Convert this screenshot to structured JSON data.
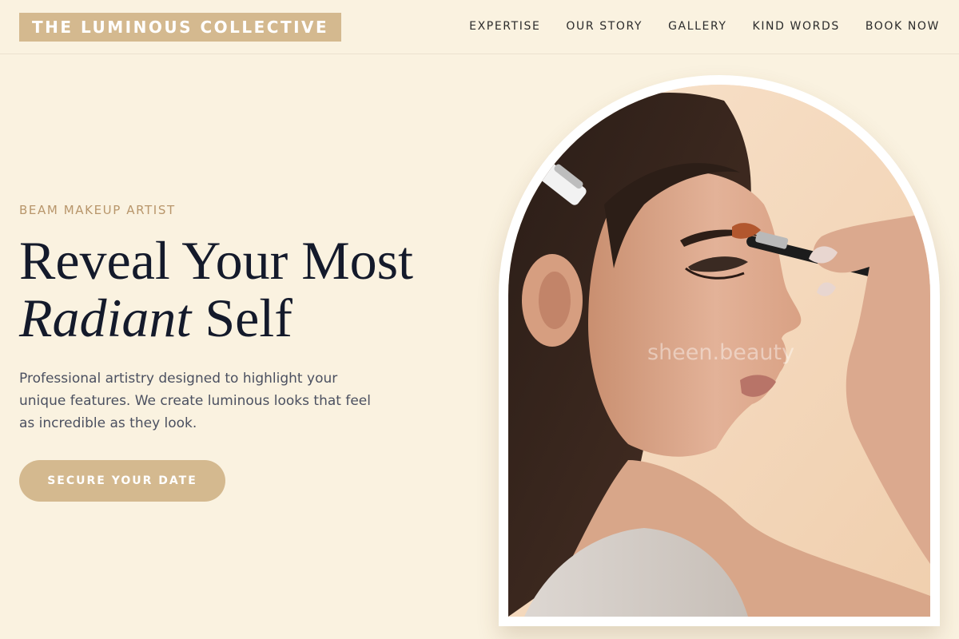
{
  "brand": {
    "name": "THE LUMINOUS COLLECTIVE"
  },
  "nav": {
    "items": [
      {
        "label": "EXPERTISE"
      },
      {
        "label": "OUR STORY"
      },
      {
        "label": "GALLERY"
      },
      {
        "label": "KIND WORDS"
      },
      {
        "label": "BOOK NOW"
      }
    ]
  },
  "hero": {
    "eyebrow": "BEAM MAKEUP ARTIST",
    "headline_line1": "Reveal Your Most",
    "headline_emphasis": "Radiant",
    "headline_tail": " Self",
    "description": "Professional artistry designed to highlight your unique features. We create luminous looks that feel as incredible as they look.",
    "cta_label": "SECURE YOUR DATE"
  },
  "image": {
    "subject": "makeup-application-portrait",
    "watermark": "sheen.beauty"
  },
  "colors": {
    "background": "#faf2e0",
    "accent": "#d4b98f",
    "eyebrow": "#b8966b",
    "headline": "#141a2b",
    "body_text": "#4b5060"
  }
}
